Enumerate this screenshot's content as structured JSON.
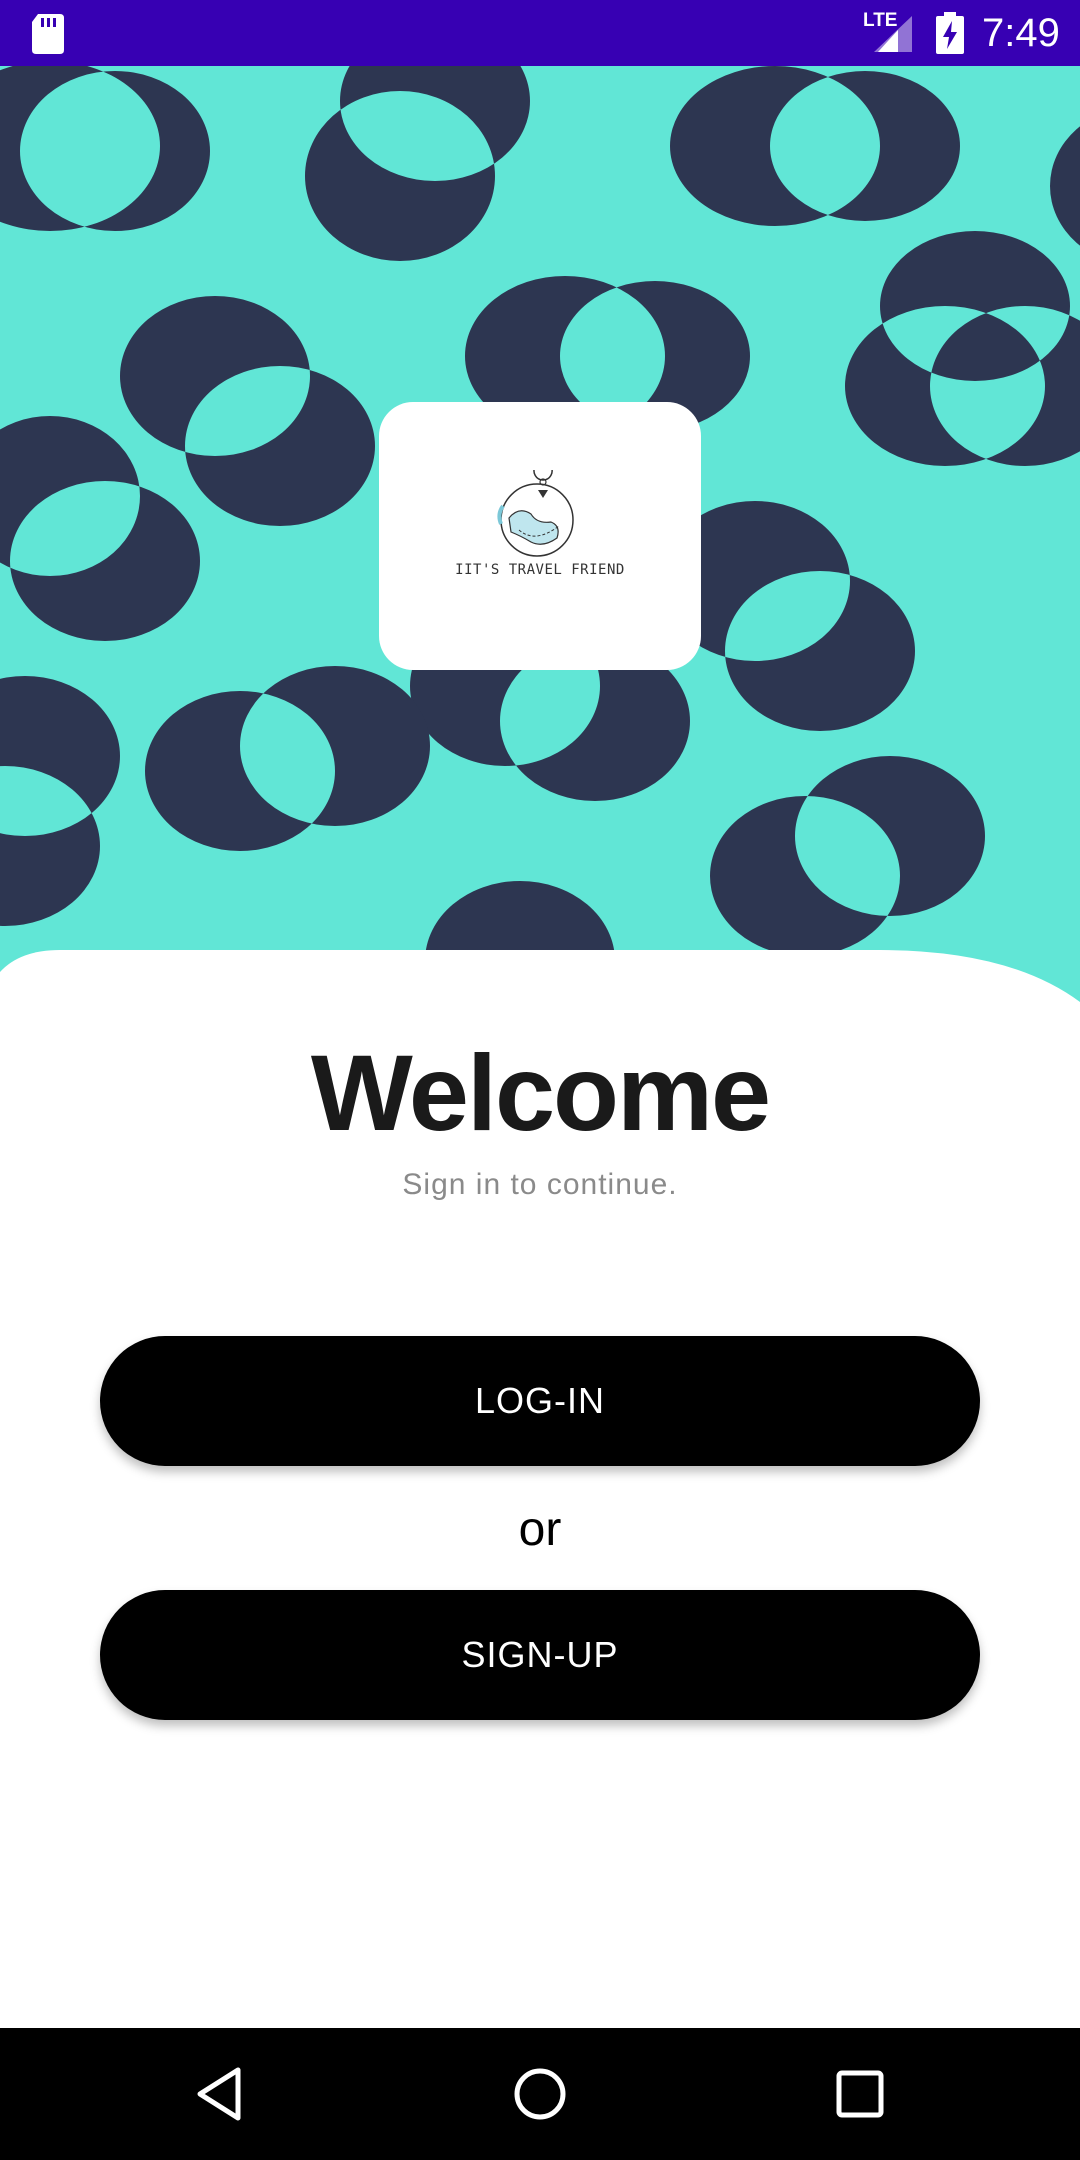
{
  "status_bar": {
    "network": "LTE",
    "time": "7:49",
    "icons": [
      "sd-card-icon",
      "signal-icon",
      "battery-charging-icon"
    ],
    "background": "#3700b3"
  },
  "hero": {
    "background": "#61e6d6",
    "pattern_color": "#2d3651",
    "logo_text": "IIT'S TRAVEL FRIEND",
    "logo_icon": "globe-map-pin-icon"
  },
  "main": {
    "title": "Welcome",
    "subtitle": "Sign in to continue.",
    "login_label": "LOG-IN",
    "or_label": "or",
    "signup_label": "SIGN-UP"
  },
  "nav_bar": {
    "icons": [
      "back-icon",
      "home-icon",
      "recents-icon"
    ]
  }
}
